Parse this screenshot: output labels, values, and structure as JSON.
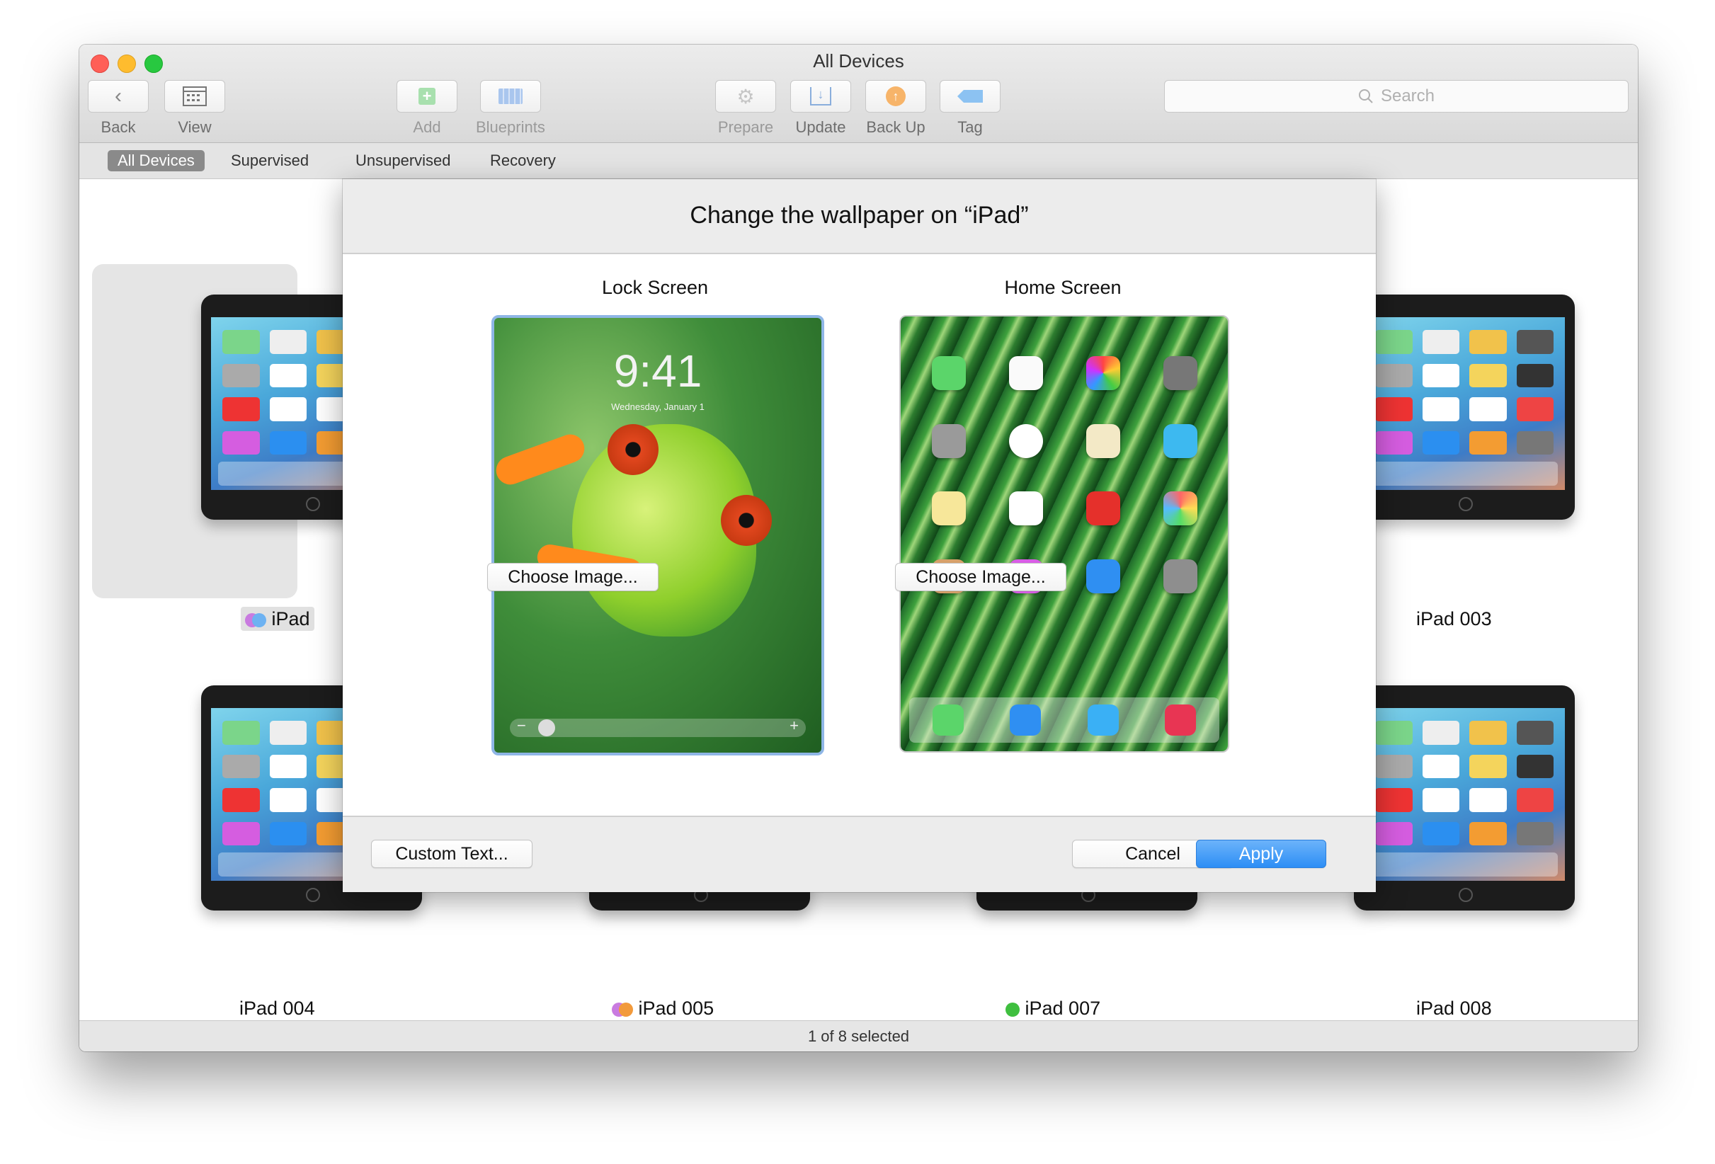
{
  "window": {
    "title": "All Devices"
  },
  "toolbar": {
    "back": "Back",
    "view": "View",
    "add": "Add",
    "blueprints": "Blueprints",
    "prepare": "Prepare",
    "update": "Update",
    "backup": "Back Up",
    "tag": "Tag"
  },
  "search": {
    "placeholder": "Search"
  },
  "scopes": [
    "All Devices",
    "Supervised",
    "Unsupervised",
    "Recovery"
  ],
  "devices": [
    {
      "name": "iPad",
      "tags": [
        "#c97be0",
        "#6db2f2"
      ]
    },
    {
      "name": "iPad 003",
      "tags": []
    },
    {
      "name": "iPad 004",
      "tags": []
    },
    {
      "name": "iPad 005",
      "tags": [
        "#c97be0",
        "#f29a3c"
      ]
    },
    {
      "name": "iPad 007",
      "tags": [
        "#3fbf3f"
      ]
    },
    {
      "name": "iPad 008",
      "tags": []
    }
  ],
  "status": "1 of 8 selected",
  "sheet": {
    "title": "Change the wallpaper on “iPad”",
    "lock_label": "Lock Screen",
    "home_label": "Home Screen",
    "lock_time": "9:41",
    "lock_date": "Wednesday, January 1",
    "choose_image": "Choose Image...",
    "custom_text": "Custom Text...",
    "cancel": "Cancel",
    "apply": "Apply"
  },
  "colors": {
    "accent": "#2d8ef5",
    "selection_ring": "#8fb6e6"
  }
}
